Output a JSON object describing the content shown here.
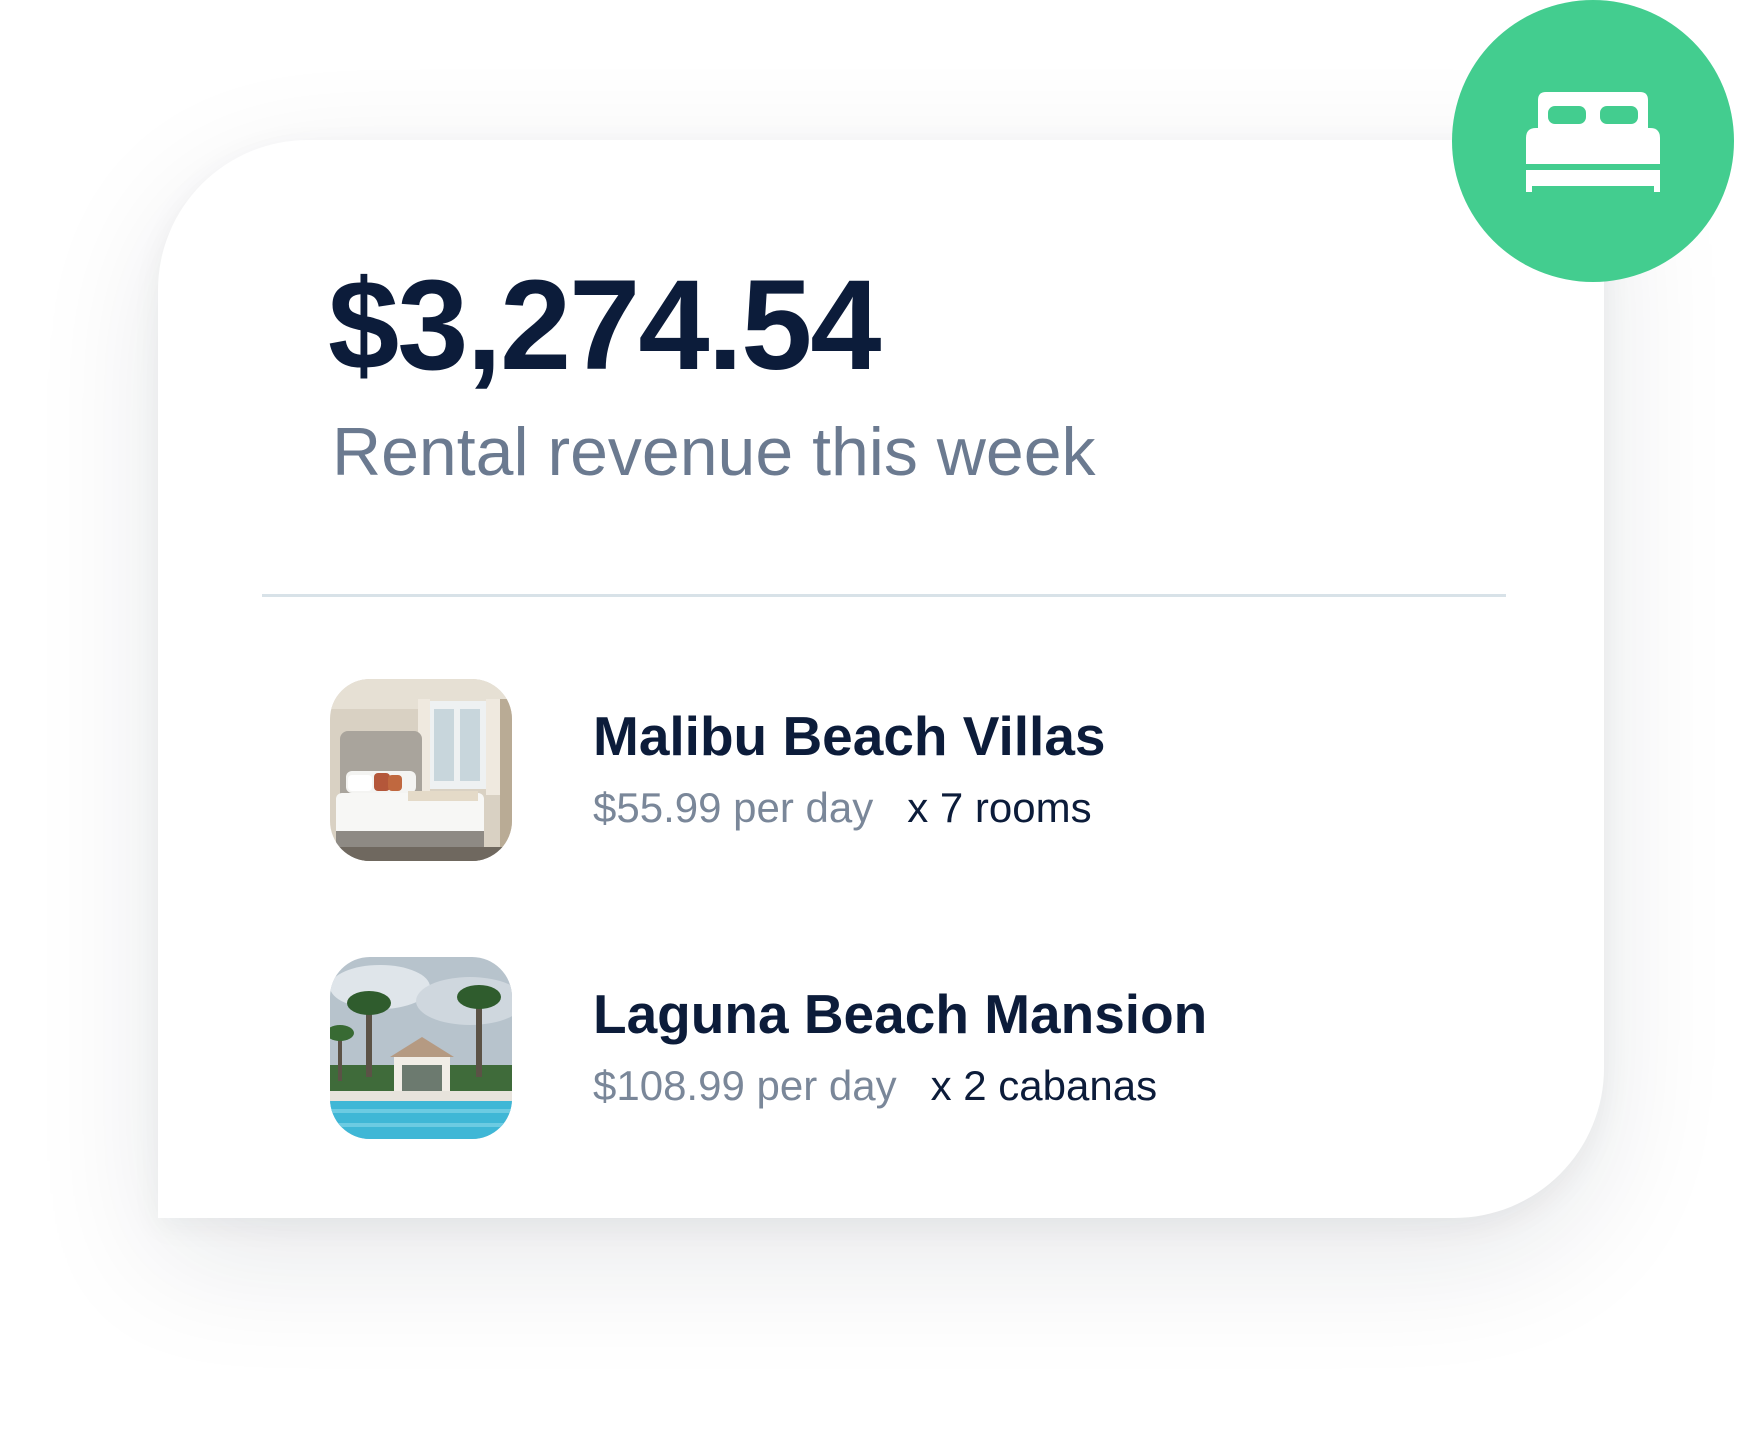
{
  "summary": {
    "amount": "$3,274.54",
    "label": "Rental revenue this week"
  },
  "badge": {
    "icon": "bed-icon",
    "color": "#43cd8f"
  },
  "rentals": [
    {
      "name": "Malibu Beach Villas",
      "price": "$55.99 per day",
      "quantity": "x 7 rooms",
      "thumbnail": "bedroom-photo"
    },
    {
      "name": "Laguna Beach Mansion",
      "price": "$108.99 per day",
      "quantity": "x 2 cabanas",
      "thumbnail": "pool-cabana-photo"
    }
  ]
}
